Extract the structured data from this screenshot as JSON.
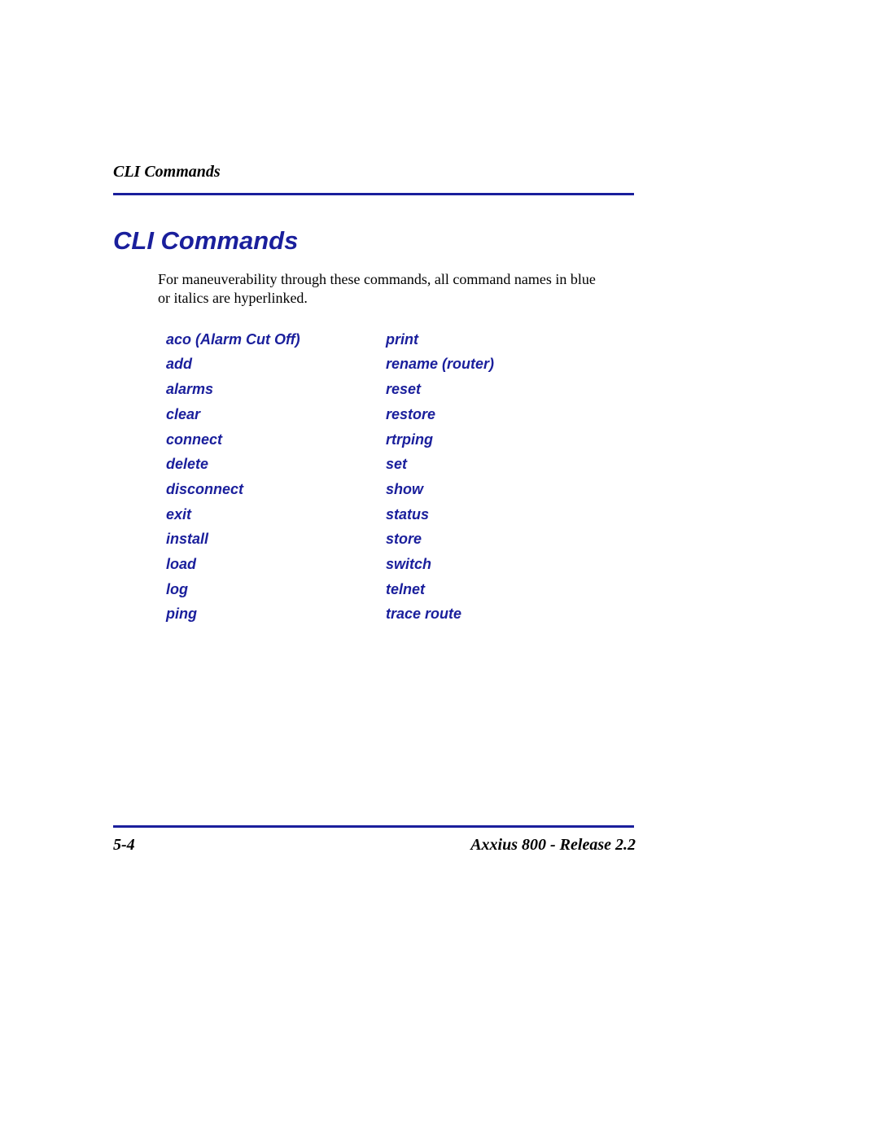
{
  "header": {
    "running_title": "CLI Commands"
  },
  "main": {
    "heading": "CLI Commands",
    "intro": "For maneuverability through these commands, all command names in blue or italics are hyperlinked.",
    "commands_col1": [
      "aco (Alarm Cut Off)",
      "add",
      "alarms",
      "clear",
      "connect",
      "delete",
      "disconnect",
      "exit",
      "install",
      "load",
      "log",
      "ping"
    ],
    "commands_col2": [
      "print",
      "rename (router)",
      "reset",
      "restore",
      "rtrping",
      "set",
      "show",
      "status",
      "store",
      "switch",
      "telnet",
      "trace route"
    ]
  },
  "footer": {
    "page_number": "5-4",
    "doc_title": "Axxius 800 - Release 2.2"
  }
}
